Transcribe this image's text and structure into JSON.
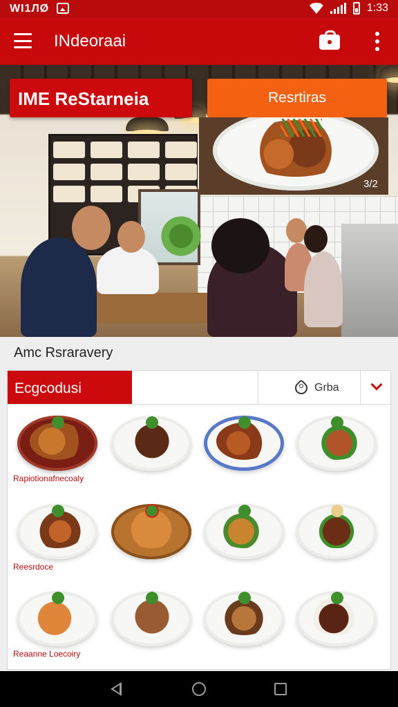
{
  "status_bar": {
    "left_text": "WI1ЛØ",
    "time": "1:33",
    "icons": [
      "image-icon",
      "wifi-icon",
      "signal-icon",
      "battery-icon"
    ]
  },
  "app_bar": {
    "title": "INdeoraai",
    "icons": [
      "hamburger-icon",
      "cart-icon",
      "more-icon"
    ],
    "color": "#c8090c"
  },
  "hero": {
    "brand_label": "IME ReStarneia",
    "button_label": "Resrtiras",
    "dish_count": "3/2",
    "brand_color": "#cc0a0e",
    "button_color": "#f46112"
  },
  "content": {
    "section_title": "Amc Rsraravery",
    "filter_tab_label": "Ecgcodusi",
    "filter_search_label": "Grba",
    "filter_icons": [
      "tag-icon",
      "chevron-down-icon"
    ],
    "dishes": [
      {
        "label": "Rapiotionafnecoaly"
      },
      {
        "label": ""
      },
      {
        "label": ""
      },
      {
        "label": ""
      },
      {
        "label": "Reesrdoce"
      },
      {
        "label": ""
      },
      {
        "label": ""
      },
      {
        "label": ""
      },
      {
        "label": "Reaanne Loecoiry"
      },
      {
        "label": ""
      },
      {
        "label": ""
      },
      {
        "label": ""
      }
    ]
  },
  "nav_bar": {
    "icons": [
      "back-icon",
      "home-icon",
      "recents-icon"
    ]
  }
}
